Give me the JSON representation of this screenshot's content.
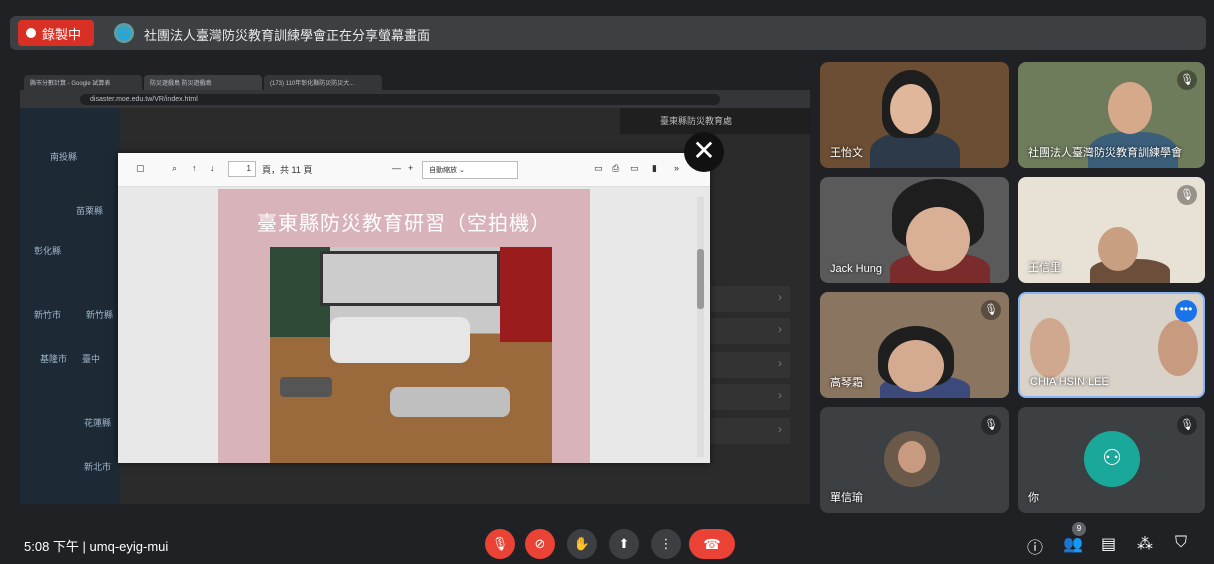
{
  "banner": {
    "record_label": "錄製中",
    "share_message": "社團法人臺灣防災教育訓練學會正在分享螢幕畫面"
  },
  "browser": {
    "tabs": [
      "縣市分數計算 - Google 試算表",
      "防災遊戲島 防災遊戲島",
      "(173) 110年彰化縣防災防災大..."
    ],
    "url": "disaster.moe.edu.tw/VR/index.html"
  },
  "site": {
    "map_labels": [
      "南投縣",
      "苗栗縣",
      "彰化縣",
      "新竹市",
      "新竹縣",
      "基隆市",
      "臺中",
      "花蓮縣",
      "新北市"
    ],
    "panel_title": "臺東縣防災教育處"
  },
  "pdf": {
    "page_current": "1",
    "page_total_label": "頁，共 11 頁",
    "zoom": "自動縮放",
    "slide_title": "臺東縣防災教育研習（空拍機）"
  },
  "participants": [
    {
      "name": "王怡文",
      "muted": false
    },
    {
      "name": "社團法人臺灣防災教育訓練學會",
      "muted": true
    },
    {
      "name": "Jack Hung",
      "muted": false
    },
    {
      "name": "王信里",
      "muted": true
    },
    {
      "name": "高琴霜",
      "muted": true
    },
    {
      "name": "CHIA HSIN LEE",
      "muted": false
    },
    {
      "name": "單信瑜",
      "muted": true
    },
    {
      "name": "你",
      "muted": true
    }
  ],
  "meeting": {
    "time": "5:08 下午",
    "code": "umq-eyig-mui",
    "participant_count": "9"
  },
  "colors": {
    "record_red": "#d93025",
    "hangup_red": "#ea4335",
    "background": "#202124"
  }
}
